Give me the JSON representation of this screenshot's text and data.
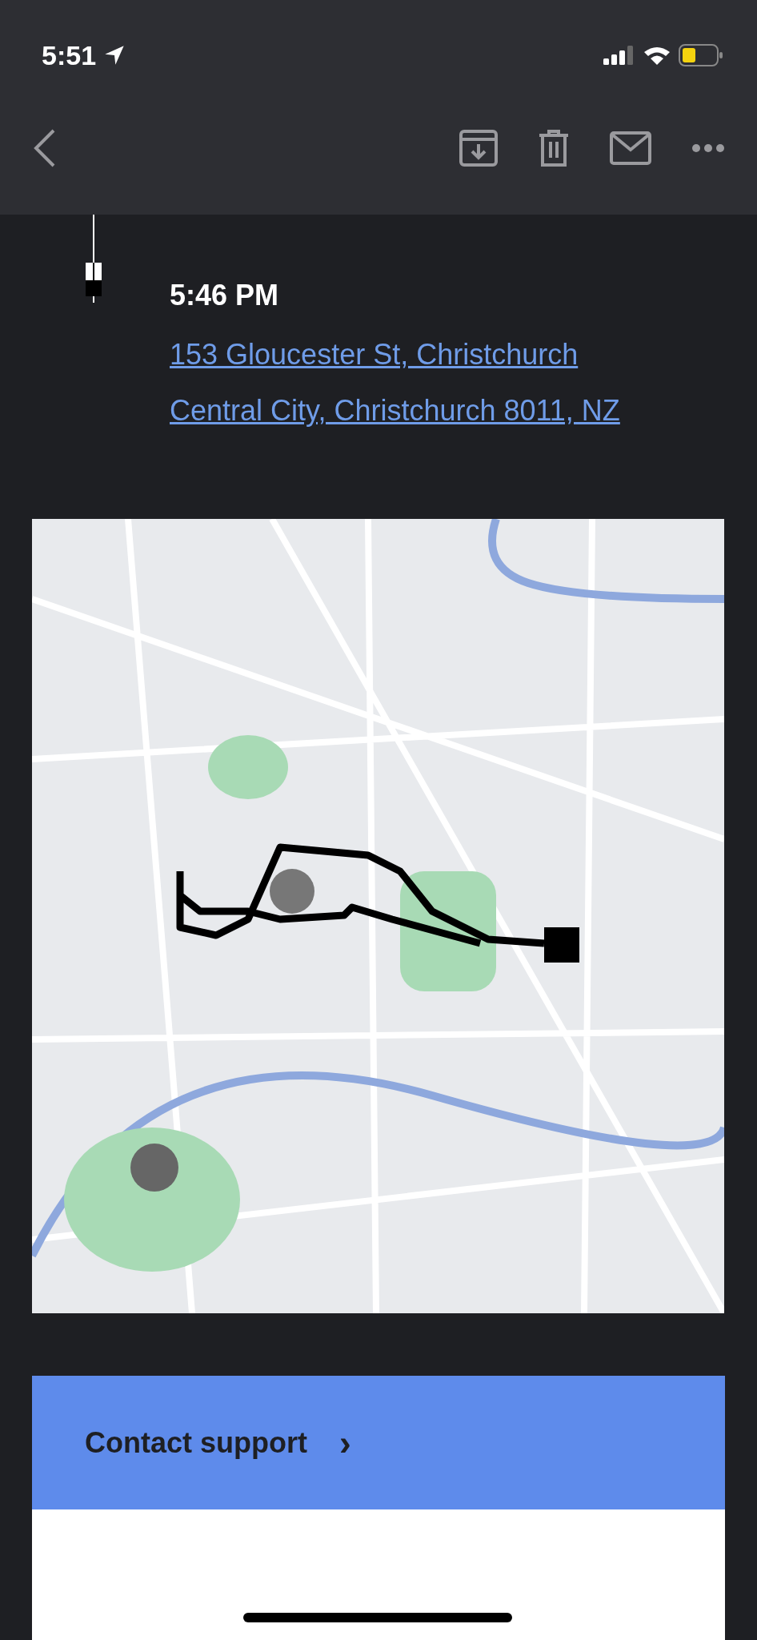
{
  "status_bar": {
    "time": "5:51"
  },
  "trip_stop": {
    "time": "5:46 PM",
    "address": "153 Gloucester St, Christchurch Central City, Christchurch 8011, NZ"
  },
  "support_button": {
    "label": "Contact support",
    "arrow": "›"
  }
}
